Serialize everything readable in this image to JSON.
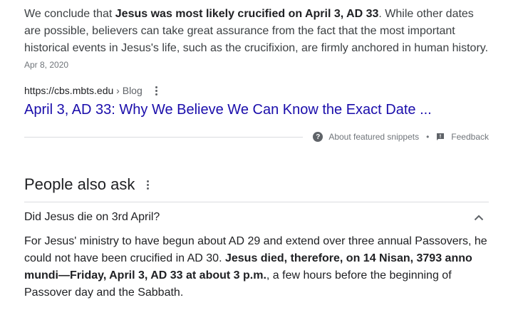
{
  "featured_snippet": {
    "text_before": "We conclude that ",
    "text_bold": "Jesus was most likely crucified on April 3, AD 33",
    "text_after": ". While other dates are possible, believers can take great assurance from the fact that the most important historical events in Jesus's life, such as the crucifixion, are firmly anchored in human history.",
    "date": "Apr 8, 2020"
  },
  "source": {
    "url": "https://cbs.mbts.edu",
    "breadcrumb": " › Blog",
    "title": "April 3, AD 33: Why We Believe We Can Know the Exact Date ..."
  },
  "feedback_bar": {
    "about_label": "About featured snippets",
    "separator": "•",
    "feedback_label": "Feedback"
  },
  "people_also_ask": {
    "heading": "People also ask",
    "question": "Did Jesus die on 3rd April?",
    "answer_before": "For Jesus' ministry to have begun about AD 29 and extend over three annual Passovers, he could not have been crucified in AD 30. ",
    "answer_bold": "Jesus died, therefore, on 14 Nisan, 3793 anno mundi—Friday, April 3, AD 33 at about 3 p.m.",
    "answer_after": ", a few hours before the beginning of Passover day and the Sabbath."
  },
  "icons": {
    "more": "more-vert-icon",
    "help": "help-circle-icon",
    "feedback": "feedback-icon",
    "collapse": "chevron-up-icon"
  },
  "colors": {
    "link": "#1a0dab",
    "text": "#202124",
    "secondary": "#70757a"
  }
}
